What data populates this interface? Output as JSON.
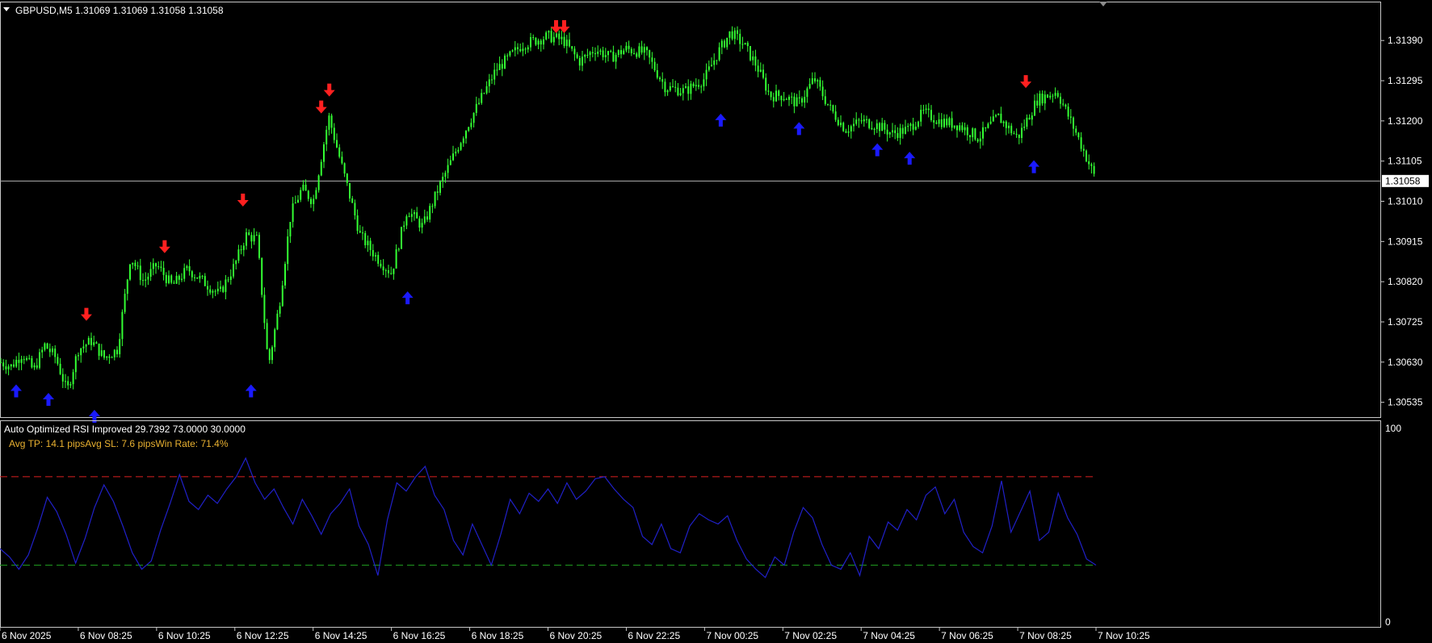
{
  "main": {
    "symbol_label": "GBPUSD,M5",
    "ohlc_label": "1.31069 1.31069 1.31058 1.31058",
    "current_price_label": "1.31058",
    "current_price": 1.31058,
    "price_ticks": [
      "1.31390",
      "1.31295",
      "1.31200",
      "1.31105",
      "1.31010",
      "1.30915",
      "1.30820",
      "1.30725",
      "1.30630",
      "1.30535"
    ],
    "price_ticks_values": [
      1.3139,
      1.31295,
      1.312,
      1.31105,
      1.3101,
      1.30915,
      1.3082,
      1.30725,
      1.3063,
      1.30535
    ]
  },
  "indicator": {
    "name_label": "Auto Optimized RSI Improved 29.7392 73.0000 30.0000",
    "stats_label": "Avg TP: 14.1 pipsAvg SL: 7.6 pipsWin Rate: 71.4%",
    "scale_max_label": "100",
    "scale_min_label": "0",
    "upper_level": 73,
    "lower_level": 30
  },
  "time_axis": {
    "labels": [
      "6 Nov 2025",
      "6 Nov 08:25",
      "6 Nov 10:25",
      "6 Nov 12:25",
      "6 Nov 14:25",
      "6 Nov 16:25",
      "6 Nov 18:25",
      "6 Nov 20:25",
      "6 Nov 22:25",
      "7 Nov 00:25",
      "7 Nov 02:25",
      "7 Nov 04:25",
      "7 Nov 06:25",
      "7 Nov 08:25",
      "7 Nov 10:25"
    ]
  },
  "colors": {
    "background": "#000000",
    "border": "#c8c8c8",
    "text": "#ffffff",
    "stats_text": "#e8b030",
    "candle": "#33ff33",
    "sell_arrow": "#ff2020",
    "buy_arrow": "#1a1aff",
    "rsi_line": "#2020c8",
    "upper_level_line": "#dd2020",
    "lower_level_line": "#1f9a1f",
    "price_line": "#b0b0b0"
  },
  "chart_data": [
    {
      "type": "candlestick",
      "symbol": "GBPUSD",
      "timeframe": "M5",
      "ylim": [
        1.305,
        1.3148
      ],
      "close_path": [
        {
          "t": "6 Nov 2025",
          "price": 1.3063
        },
        {
          "t": "",
          "price": 1.3062
        },
        {
          "t": "",
          "price": 1.3065
        },
        {
          "t": "",
          "price": 1.3061
        },
        {
          "t": "",
          "price": 1.3067
        },
        {
          "t": "",
          "price": 1.3064
        },
        {
          "t": "",
          "price": 1.3056
        },
        {
          "t": "6 Nov 08:25",
          "price": 1.3066
        },
        {
          "t": "",
          "price": 1.3068
        },
        {
          "t": "",
          "price": 1.3064
        },
        {
          "t": "",
          "price": 1.3066
        },
        {
          "t": "",
          "price": 1.3088
        },
        {
          "t": "",
          "price": 1.3082
        },
        {
          "t": "6 Nov 10:25",
          "price": 1.3086
        },
        {
          "t": "",
          "price": 1.3081
        },
        {
          "t": "",
          "price": 1.3085
        },
        {
          "t": "",
          "price": 1.3082
        },
        {
          "t": "",
          "price": 1.3079
        },
        {
          "t": "6 Nov 12:25",
          "price": 1.3086
        },
        {
          "t": "",
          "price": 1.3093
        },
        {
          "t": "",
          "price": 1.3092
        },
        {
          "t": "",
          "price": 1.3062
        },
        {
          "t": "",
          "price": 1.3077
        },
        {
          "t": "",
          "price": 1.3098
        },
        {
          "t": "",
          "price": 1.3104
        },
        {
          "t": "6 Nov 14:25",
          "price": 1.3101
        },
        {
          "t": "",
          "price": 1.3121
        },
        {
          "t": "",
          "price": 1.3107
        },
        {
          "t": "",
          "price": 1.3093
        },
        {
          "t": "",
          "price": 1.3088
        },
        {
          "t": "6 Nov 16:25",
          "price": 1.3084
        },
        {
          "t": "",
          "price": 1.3099
        },
        {
          "t": "",
          "price": 1.3095
        },
        {
          "t": "",
          "price": 1.3104
        },
        {
          "t": "",
          "price": 1.3112
        },
        {
          "t": "6 Nov 18:25",
          "price": 1.312
        },
        {
          "t": "",
          "price": 1.3132
        },
        {
          "t": "",
          "price": 1.3138
        },
        {
          "t": "6 Nov 20:25",
          "price": 1.314
        },
        {
          "t": "",
          "price": 1.3139
        },
        {
          "t": "",
          "price": 1.3134
        },
        {
          "t": "",
          "price": 1.3137
        },
        {
          "t": "",
          "price": 1.3135
        },
        {
          "t": "6 Nov 22:25",
          "price": 1.3137
        },
        {
          "t": "",
          "price": 1.3136
        },
        {
          "t": "",
          "price": 1.3128
        },
        {
          "t": "",
          "price": 1.3127
        },
        {
          "t": "7 Nov 00:25",
          "price": 1.313
        },
        {
          "t": "",
          "price": 1.3136
        },
        {
          "t": "",
          "price": 1.3141
        },
        {
          "t": "",
          "price": 1.3138
        },
        {
          "t": "",
          "price": 1.3133
        },
        {
          "t": "",
          "price": 1.3126
        },
        {
          "t": "7 Nov 02:25",
          "price": 1.3126
        },
        {
          "t": "",
          "price": 1.3124
        },
        {
          "t": "",
          "price": 1.313
        },
        {
          "t": "",
          "price": 1.3123
        },
        {
          "t": "",
          "price": 1.3118
        },
        {
          "t": "7 Nov 04:25",
          "price": 1.312
        },
        {
          "t": "",
          "price": 1.3119
        },
        {
          "t": "",
          "price": 1.3117
        },
        {
          "t": "",
          "price": 1.3118
        },
        {
          "t": "",
          "price": 1.3122
        },
        {
          "t": "7 Nov 06:25",
          "price": 1.312
        },
        {
          "t": "",
          "price": 1.3119
        },
        {
          "t": "",
          "price": 1.3116
        },
        {
          "t": "",
          "price": 1.3121
        },
        {
          "t": "7 Nov 08:25",
          "price": 1.3116
        },
        {
          "t": "",
          "price": 1.3125
        },
        {
          "t": "",
          "price": 1.3127
        },
        {
          "t": "",
          "price": 1.3117
        },
        {
          "t": "7 Nov 10:25",
          "price": 1.3106
        }
      ],
      "sell_signals": [
        {
          "t": "6 Nov 08:25",
          "price": 1.3072
        },
        {
          "t": "6 Nov 10:25",
          "price": 1.3088
        },
        {
          "t": "6 Nov 12:25",
          "price": 1.3099
        },
        {
          "t": "6 Nov 14:25",
          "price": 1.3121
        },
        {
          "t": "6 Nov 14:25",
          "price": 1.3125
        },
        {
          "t": "6 Nov 20:25",
          "price": 1.314
        },
        {
          "t": "6 Nov 20:25",
          "price": 1.314
        },
        {
          "t": "7 Nov 08:25",
          "price": 1.3127
        }
      ],
      "buy_signals": [
        {
          "t": "6 Nov 2025",
          "price": 1.306
        },
        {
          "t": "6 Nov 2025",
          "price": 1.3058
        },
        {
          "t": "6 Nov 08:25",
          "price": 1.3054
        },
        {
          "t": "6 Nov 12:25",
          "price": 1.306
        },
        {
          "t": "6 Nov 16:25",
          "price": 1.3082
        },
        {
          "t": "7 Nov 00:25",
          "price": 1.3124
        },
        {
          "t": "7 Nov 02:25",
          "price": 1.3122
        },
        {
          "t": "7 Nov 04:25",
          "price": 1.3117
        },
        {
          "t": "7 Nov 04:25",
          "price": 1.3115
        },
        {
          "t": "7 Nov 08:25",
          "price": 1.3113
        }
      ]
    },
    {
      "type": "line",
      "title": "Auto Optimized RSI Improved",
      "ylim": [
        0,
        100
      ],
      "levels": [
        73,
        30
      ],
      "values": [
        38,
        34,
        28,
        35,
        48,
        63,
        56,
        45,
        31,
        43,
        58,
        69,
        61,
        49,
        36,
        28,
        32,
        47,
        60,
        74,
        61,
        57,
        64,
        60,
        67,
        73,
        82,
        70,
        62,
        67,
        58,
        50,
        62,
        54,
        45,
        55,
        60,
        67,
        49,
        40,
        25,
        52,
        70,
        66,
        73,
        78,
        64,
        57,
        42,
        35,
        50,
        40,
        30,
        45,
        62,
        55,
        65,
        61,
        67,
        60,
        70,
        62,
        66,
        72,
        73,
        67,
        62,
        58,
        44,
        40,
        50,
        38,
        36,
        49,
        55,
        52,
        50,
        54,
        42,
        33,
        28,
        24,
        34,
        30,
        46,
        58,
        53,
        40,
        30,
        28,
        36,
        25,
        44,
        38,
        51,
        47,
        57,
        52,
        64,
        68,
        55,
        62,
        46,
        39,
        36,
        49,
        71,
        46,
        56,
        66,
        42,
        46,
        65,
        53,
        45,
        33,
        30
      ]
    }
  ]
}
